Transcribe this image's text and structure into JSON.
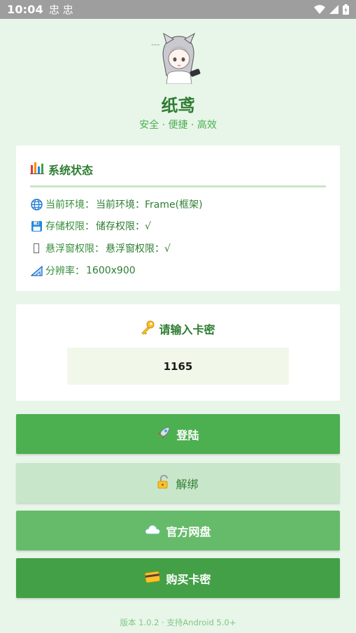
{
  "status_bar": {
    "time": "10:04",
    "notification_icons": "忠 忠"
  },
  "app": {
    "title": "纸鸢",
    "subtitle": "安全 · 便捷 · 高效"
  },
  "system_status": {
    "title": "系统状态",
    "rows": [
      {
        "icon": "globe-icon",
        "label": "当前环境：",
        "value": "当前环境：Frame(框架)"
      },
      {
        "icon": "floppy-disk-icon",
        "label": "存储权限：",
        "value": "储存权限：√"
      },
      {
        "icon": "placeholder-glyph-icon",
        "label": "悬浮窗权限：",
        "value": "悬浮窗权限：√"
      },
      {
        "icon": "triangle-ruler-icon",
        "label": "分辨率：",
        "value": "1600x900"
      }
    ]
  },
  "key_entry": {
    "prompt": "请输入卡密",
    "input_value": "1165"
  },
  "buttons": {
    "login": "登陆",
    "unbind": "解绑",
    "cloud_disk": "官方网盘",
    "buy_key": "购买卡密"
  },
  "footer": "版本 1.0.2 · 支持Android 5.0+",
  "colors": {
    "background": "#e8f5e9",
    "primary": "#4caf50",
    "dark_green": "#2e7d32",
    "light_green": "#c8e6c9",
    "statusbar": "#9e9e9e"
  }
}
